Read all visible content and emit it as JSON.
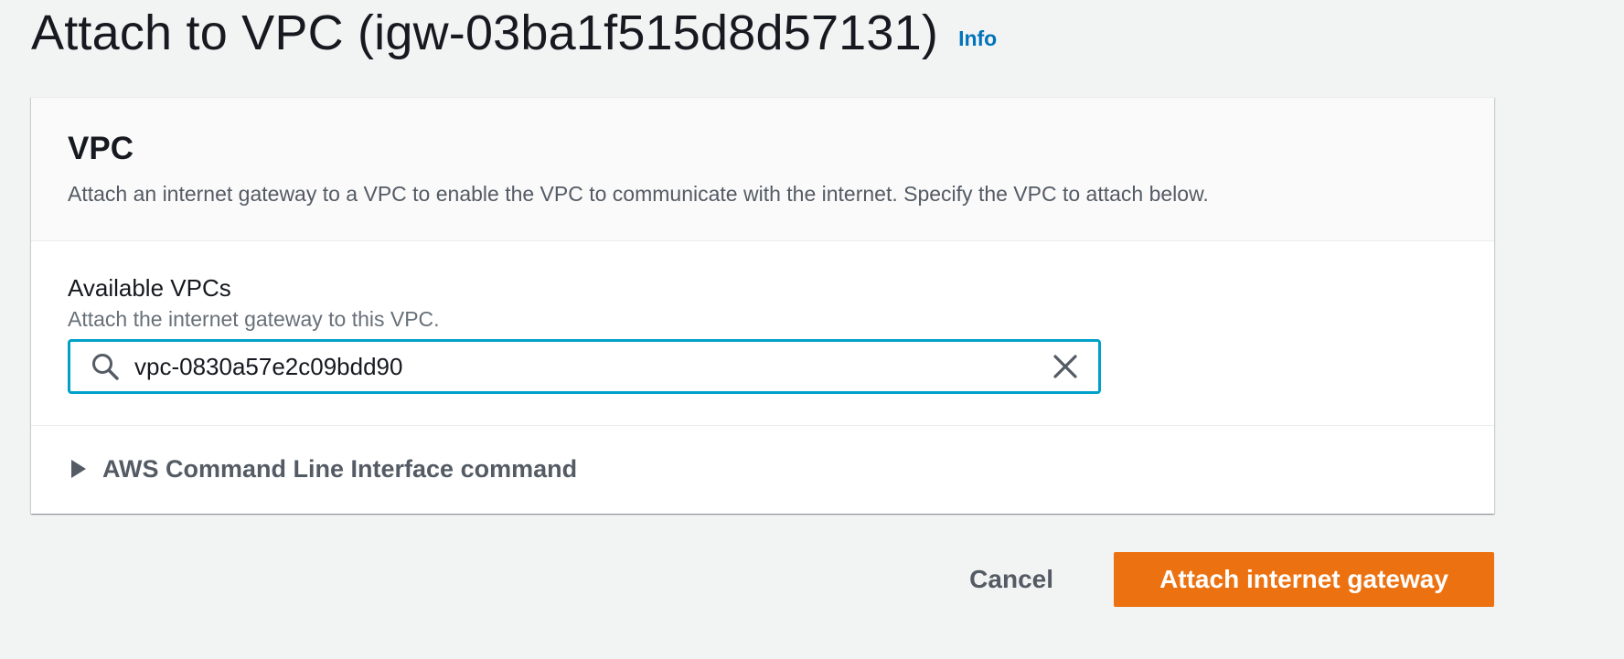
{
  "page": {
    "title": "Attach to VPC (igw-03ba1f515d8d57131)",
    "info_link": "Info"
  },
  "panel": {
    "title": "VPC",
    "description": "Attach an internet gateway to a VPC to enable the VPC to communicate with the internet. Specify the VPC to attach below.",
    "field": {
      "label": "Available VPCs",
      "description": "Attach the internet gateway to this VPC.",
      "value": "vpc-0830a57e2c09bdd90",
      "icons": {
        "search": "search-icon",
        "clear": "close-icon"
      }
    },
    "expandable": {
      "label": "AWS Command Line Interface command",
      "icon": "caret-right-icon",
      "expanded": false
    }
  },
  "actions": {
    "cancel_label": "Cancel",
    "submit_label": "Attach internet gateway"
  },
  "colors": {
    "background": "#f2f3f3",
    "link": "#0073bb",
    "focus_border": "#00a1c9",
    "primary_button": "#ec7211",
    "text": "#16191f",
    "secondary_text": "#545b64"
  }
}
